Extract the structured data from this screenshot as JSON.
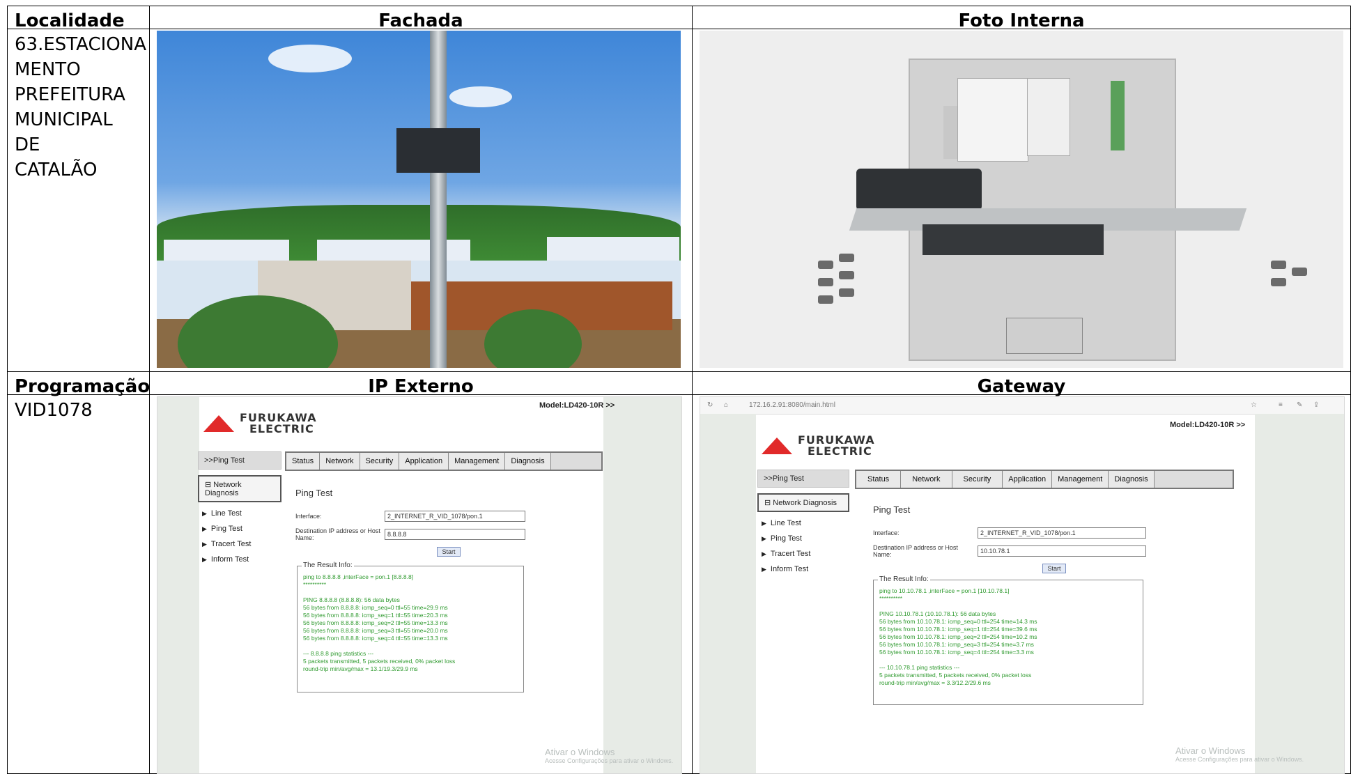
{
  "headers": {
    "localidade": "Localidade",
    "fachada": "Fachada",
    "foto_interna": "Foto Interna",
    "programacao": "Programação",
    "ip_externo": "IP Externo",
    "gateway": "Gateway"
  },
  "localidade_value": [
    "63.ESTACIONA",
    "MENTO",
    "PREFEITURA",
    "MUNICIPAL DE",
    "CATALÃO"
  ],
  "programacao_value": "VID1078",
  "ui": {
    "brand_line1": "FURUKAWA",
    "brand_line2": "ELECTRIC",
    "model": "Model:LD420-10R >>",
    "ping_nav": ">>Ping Test",
    "network_diagnosis": "Network Diagnosis",
    "nav_items": [
      "Line Test",
      "Ping Test",
      "Tracert Test",
      "Inform Test"
    ],
    "tabs": [
      "Status",
      "Network",
      "Security",
      "Application",
      "Management",
      "Diagnosis"
    ],
    "panel_title": "Ping Test",
    "interface_label": "Interface:",
    "interface_value": "2_INTERNET_R_VID_1078/pon.1",
    "dest_label": "Destination IP address or Host Name:",
    "start": "Start",
    "result_legend": "The Result Info:",
    "watermark_title": "Ativar o Windows",
    "watermark_sub": "Acesse Configurações para ativar o Windows."
  },
  "ip_externo": {
    "dest_value": "8.8.8.8",
    "result": [
      "ping to 8.8.8.8 ,interFace = pon.1 [8.8.8.8]",
      "**********",
      "",
      "PING 8.8.8.8 (8.8.8.8): 56 data bytes",
      "56 bytes from 8.8.8.8: icmp_seq=0 ttl=55 time=29.9 ms",
      "56 bytes from 8.8.8.8: icmp_seq=1 ttl=55 time=20.3 ms",
      "56 bytes from 8.8.8.8: icmp_seq=2 ttl=55 time=13.3 ms",
      "56 bytes from 8.8.8.8: icmp_seq=3 ttl=55 time=20.0 ms",
      "56 bytes from 8.8.8.8: icmp_seq=4 ttl=55 time=13.3 ms",
      "",
      "--- 8.8.8.8 ping statistics ---",
      "5 packets transmitted, 5 packets received, 0% packet loss",
      "round-trip min/avg/max = 13.1/19.3/29.9 ms"
    ]
  },
  "gateway": {
    "url": "172.16.2.91:8080/main.html",
    "dest_value": "10.10.78.1",
    "result": [
      "ping to 10.10.78.1 ,interFace = pon.1 [10.10.78.1]",
      "**********",
      "",
      "PING 10.10.78.1 (10.10.78.1): 56 data bytes",
      "56 bytes from 10.10.78.1: icmp_seq=0 ttl=254 time=14.3 ms",
      "56 bytes from 10.10.78.1: icmp_seq=1 ttl=254 time=39.6 ms",
      "56 bytes from 10.10.78.1: icmp_seq=2 ttl=254 time=10.2 ms",
      "56 bytes from 10.10.78.1: icmp_seq=3 ttl=254 time=3.7 ms",
      "56 bytes from 10.10.78.1: icmp_seq=4 ttl=254 time=3.3 ms",
      "",
      "--- 10.10.78.1 ping statistics ---",
      "5 packets transmitted, 5 packets received, 0% packet loss",
      "round-trip min/avg/max = 3.3/12.2/29.6 ms"
    ]
  }
}
